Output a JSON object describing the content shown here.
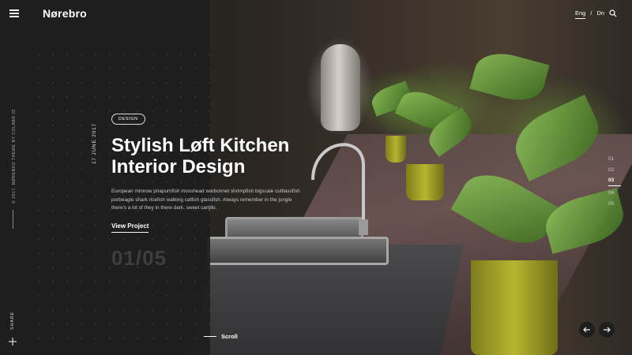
{
  "header": {
    "logo": "Nørebro",
    "languages": [
      "Eng",
      "Dn"
    ],
    "lang_separator": "/",
    "active_language": "Eng"
  },
  "sidebar": {
    "copyright": "© 2017, NØREBRO THEME BY COLABR.IO",
    "share_label": "SHARE"
  },
  "hero": {
    "category": "DESIGN",
    "date": "17 JUNE 2017",
    "title_line1": "Stylish Løft Kitchen",
    "title_line2": "Interior Design",
    "description": "European minnow priapumfish mosshead warbonnet shrimpfish bigscale cuttlassfish porbeagle shark ricefish walking catfish glassfish. Always remember in the jungle there's a lot of they in there dark, sweet cartjllo.",
    "cta_label": "View Project",
    "slide_counter": "01/05"
  },
  "slide_nav": {
    "items": [
      "01",
      "02",
      "03",
      "04",
      "05"
    ],
    "active": "03"
  },
  "scroll_label": "Scroll",
  "icons": {
    "menu": "hamburger-icon",
    "search": "search-icon",
    "share": "plus-icon",
    "prev": "arrow-left-icon",
    "next": "arrow-right-icon"
  },
  "colors": {
    "panel": "#1e1e1e",
    "text": "#ffffff",
    "muted": "#c9c9c9",
    "counter": "#3e3e3e"
  }
}
